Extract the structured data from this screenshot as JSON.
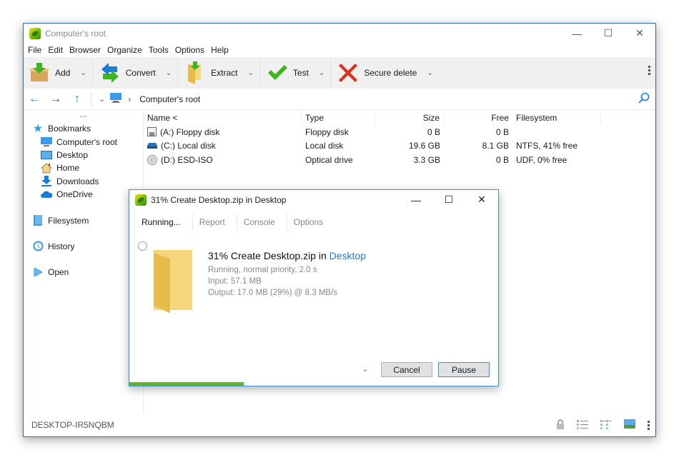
{
  "window": {
    "title": "Computer's root",
    "controls": {
      "minimize": "—",
      "maximize": "☐",
      "close": "✕"
    }
  },
  "menu": [
    "File",
    "Edit",
    "Browser",
    "Organize",
    "Tools",
    "Options",
    "Help"
  ],
  "toolbar": [
    {
      "label": "Add",
      "icon": "add-box-icon"
    },
    {
      "label": "Convert",
      "icon": "convert-arrows-icon"
    },
    {
      "label": "Extract",
      "icon": "extract-folder-icon"
    },
    {
      "label": "Test",
      "icon": "checkmark-icon"
    },
    {
      "label": "Secure delete",
      "icon": "red-x-icon"
    }
  ],
  "nav": {
    "back": "←",
    "forward": "→",
    "up": "↑",
    "dropdown": "⌄",
    "crumb_sep": "›",
    "crumb": "Computer's root"
  },
  "sidebar": {
    "dots": "...",
    "bookmarks_label": "Bookmarks",
    "bookmarks": [
      "Computer's root",
      "Desktop",
      "Home",
      "Downloads",
      "OneDrive"
    ],
    "filesystem": "Filesystem",
    "history": "History",
    "open": "Open"
  },
  "table": {
    "headers": [
      "Name <",
      "Type",
      "Size",
      "Free",
      "Filesystem"
    ],
    "rows": [
      {
        "name": "(A:) Floppy disk",
        "type": "Floppy disk",
        "size": "0 B",
        "free": "0 B",
        "fs": ""
      },
      {
        "name": "(C:) Local disk",
        "type": "Local disk",
        "size": "19.6 GB",
        "free": "8.1 GB",
        "fs": "NTFS, 41% free"
      },
      {
        "name": "(D:) ESD-ISO",
        "type": "Optical drive",
        "size": "3.3 GB",
        "free": "0 B",
        "fs": "UDF, 0% free"
      }
    ]
  },
  "status": {
    "computer": "DESKTOP-IR5NQBM"
  },
  "dialog": {
    "title": "31% Create Desktop.zip in Desktop",
    "tabs": [
      "Running...",
      "Report",
      "Console",
      "Options"
    ],
    "heading_prefix": "31% Create Desktop.zip in ",
    "heading_link": "Desktop",
    "line1": "Running, normal priority, 2.0 s",
    "line2": "Input: 57.1 MB",
    "line3": "Output: 17.0 MB (29%) @ 8.3 MB/s",
    "cancel": "Cancel",
    "pause": "Pause",
    "progress_percent": 31,
    "progress_color": "#61b918"
  }
}
